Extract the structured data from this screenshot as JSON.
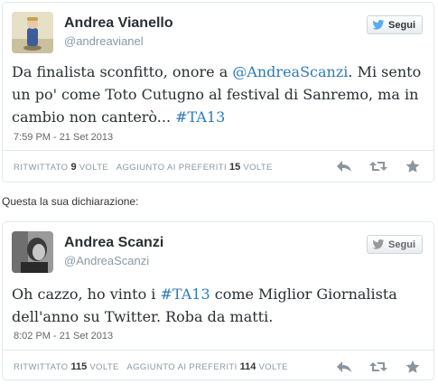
{
  "tweets": [
    {
      "name": "Andrea Vianello",
      "handle": "@andreavianel",
      "follow_label": "Segui",
      "text_parts": {
        "p1": "Da finalista sconfitto, onore a ",
        "mention": "@AndreaScanzi",
        "p2": ". Mi sento un po' come Toto Cutugno al festival di Sanremo, ma in cambio non canterò... ",
        "hashtag": "#TA13"
      },
      "timestamp": "7:59 PM - 21 Set 2013",
      "retweet_label": "RITWITTATO",
      "retweet_count": "9",
      "retweet_unit": "VOLTE",
      "fav_label": "AGGIUNTO AI PREFERITI",
      "fav_count": "15",
      "fav_unit": "VOLTE"
    },
    {
      "name": "Andrea Scanzi",
      "handle": "@AndreaScanzi",
      "follow_label": "Segui",
      "text_parts": {
        "p1": "Oh cazzo, ho vinto i ",
        "hashtag": "#TA13",
        "p2": " come Miglior Giornalista dell'anno su Twitter. Roba da matti."
      },
      "timestamp": "8:02 PM - 21 Set 2013",
      "retweet_label": "RITWITTATO",
      "retweet_count": "115",
      "retweet_unit": "VOLTE",
      "fav_label": "AGGIUNTO AI PREFERITI",
      "fav_count": "114",
      "fav_unit": "VOLTE"
    }
  ],
  "caption": "Questa la sua dichiarazione:",
  "icons": {
    "bird": "twitter-bird-icon",
    "reply": "reply-icon",
    "retweet": "retweet-icon",
    "favorite": "star-icon"
  },
  "colors": {
    "link": "#2b7bb9",
    "bird_blue": "#55acee",
    "bird_grey": "#999999",
    "icon_grey": "#8a959e"
  }
}
